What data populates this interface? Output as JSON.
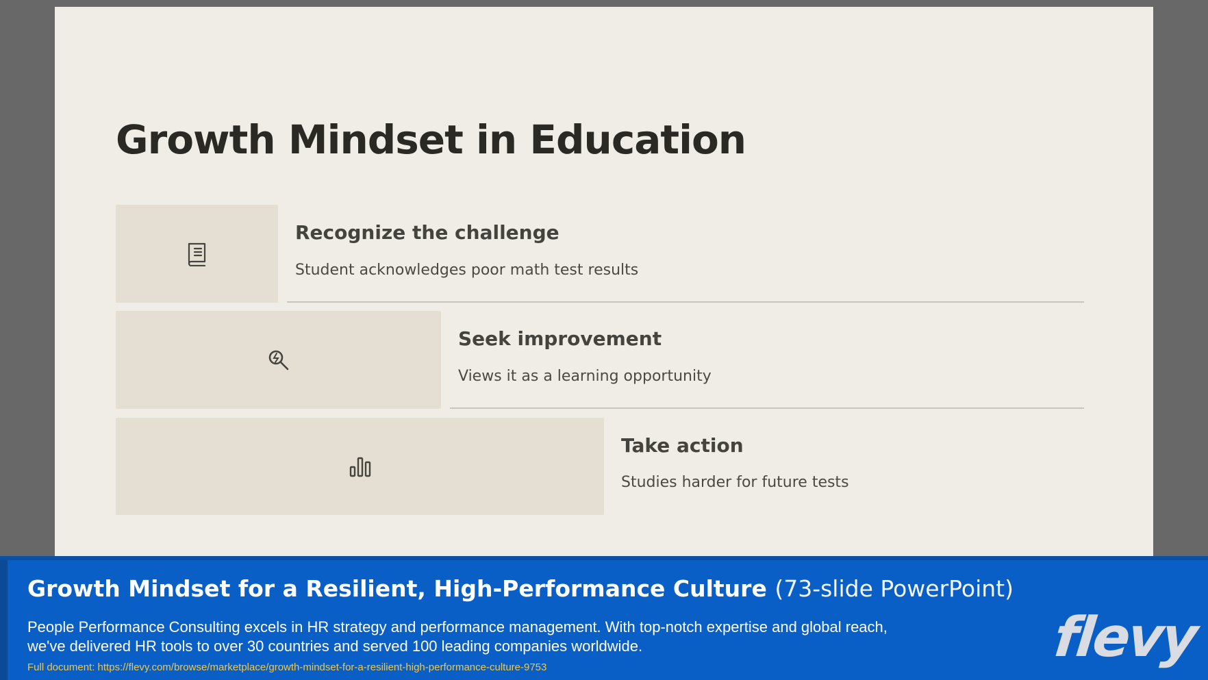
{
  "slide": {
    "title": "Growth Mindset in Education",
    "steps": [
      {
        "icon": "book-icon",
        "heading": "Recognize the challenge",
        "description": "Student acknowledges poor math test results"
      },
      {
        "icon": "search-icon",
        "heading": "Seek improvement",
        "description": "Views it as a learning opportunity"
      },
      {
        "icon": "bar-chart-icon",
        "heading": "Take action",
        "description": "Studies harder for future tests"
      }
    ]
  },
  "banner": {
    "title_bold": "Growth Mindset for a Resilient, High-Performance Culture",
    "title_light": "(73-slide PowerPoint)",
    "description": "People Performance Consulting excels in HR strategy and performance management. With top-notch expertise and global reach, we've delivered HR tools to over 30 countries and served 100 leading companies worldwide.",
    "link_text": "Full document: https://flevy.com/browse/marketplace/growth-mindset-for-a-resilient-high-performance-culture-9753",
    "logo": "flevy"
  },
  "colors": {
    "slide_background": "#f0ede6",
    "step_box": "#e5dfd3",
    "banner_blue": "#0a5fc7",
    "link_yellow": "#f2c744"
  }
}
